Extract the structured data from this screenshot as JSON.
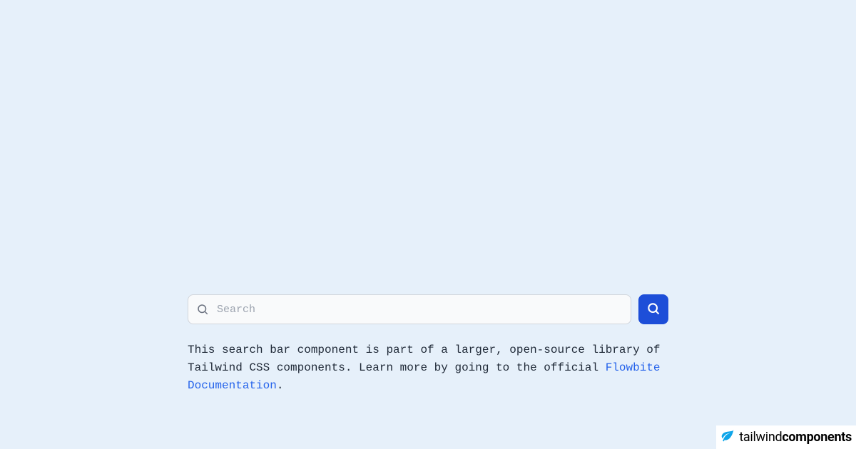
{
  "search": {
    "placeholder": "Search"
  },
  "description": {
    "text_before_link": "This search bar component is part of a larger, open-source library of Tailwind CSS components. Learn more by going to the official ",
    "link_text": "Flowbite Documentation",
    "text_after_link": "."
  },
  "branding": {
    "prefix": "tailwind",
    "suffix": "components"
  },
  "colors": {
    "background": "#e6f0fa",
    "button": "#1d4ed8",
    "link": "#2563eb",
    "input_bg": "#f9fafb",
    "border": "#d1d5db"
  }
}
